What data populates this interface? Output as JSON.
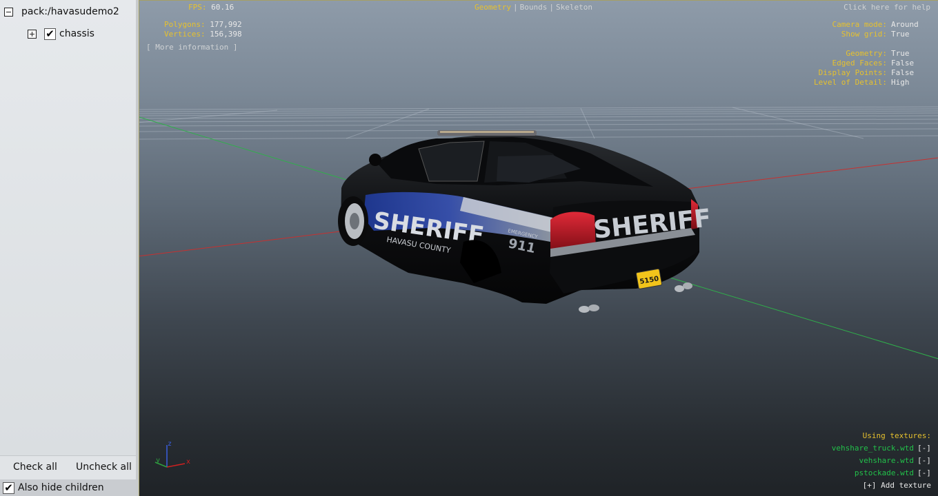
{
  "tree": {
    "root_label": "pack:/havasudemo2",
    "child_label": "chassis",
    "child_checked_glyph": "✔"
  },
  "panel": {
    "check_all": "Check all",
    "uncheck_all": "Uncheck all",
    "also_hide_children": "Also hide children",
    "checkbox_glyph": "✔"
  },
  "hud": {
    "fps_label": "FPS:",
    "fps_value": "60.16",
    "polygons_label": "Polygons:",
    "polygons_value": "177,992",
    "vertices_label": "Vertices:",
    "vertices_value": "156,398",
    "more_info": "[ More information ]",
    "tabs": [
      "Geometry",
      "Bounds",
      "Skeleton"
    ],
    "active_tab": "Geometry",
    "help": "Click here for help",
    "camera_mode_label": "Camera mode:",
    "camera_mode_value": "Around",
    "show_grid_label": "Show grid:",
    "show_grid_value": "True",
    "geometry_label": "Geometry:",
    "geometry_value": "True",
    "edged_faces_label": "Edged Faces:",
    "edged_faces_value": "False",
    "display_points_label": "Display Points:",
    "display_points_value": "False",
    "lod_label": "Level of Detail:",
    "lod_value": "High",
    "using_textures": "Using textures:",
    "textures": [
      {
        "name": "vehshare_truck.wtd",
        "action": "[-]"
      },
      {
        "name": "vehshare.wtd",
        "action": "[-]"
      },
      {
        "name": "pstockade.wtd",
        "action": "[-]"
      }
    ],
    "add_texture": "[+] Add texture"
  },
  "axis_gizmo": {
    "x": "x",
    "y": "y",
    "z": "z"
  },
  "vehicle": {
    "side_decal": "SHERIFF",
    "side_county": "HAVASU COUNTY",
    "rear_decal": "SHERIFF",
    "emergency_label": "EMERGENCY",
    "emergency_number": "911",
    "plate": "5150"
  },
  "colors": {
    "hud_label": "#e6c12e",
    "hud_value": "#e8e8e8",
    "texture_name": "#22c04a",
    "viewport_border": "#a5a064"
  }
}
